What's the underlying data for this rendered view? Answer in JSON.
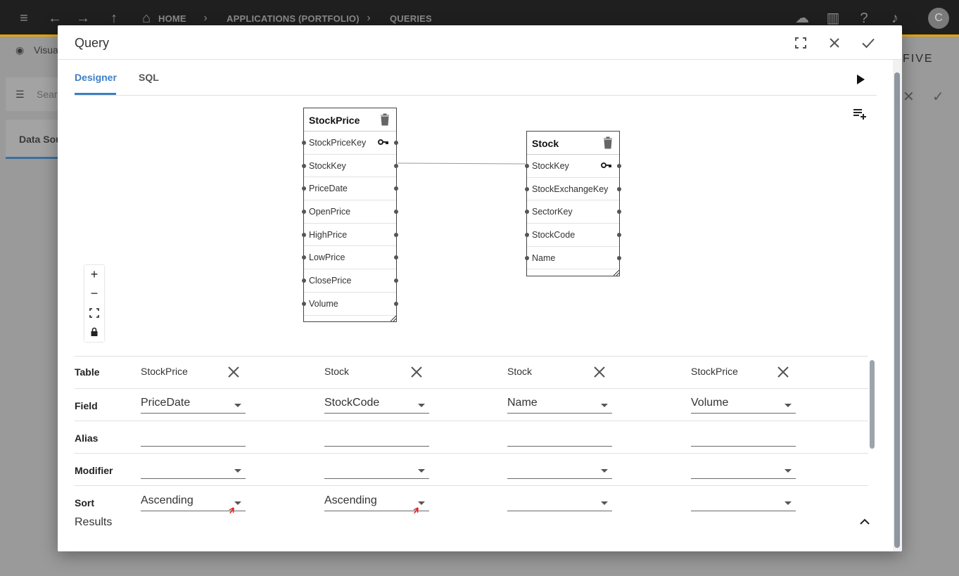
{
  "app_bar": {
    "breadcrumbs": [
      "HOME",
      "APPLICATIONS (PORTFOLIO)",
      "QUERIES"
    ],
    "avatar_initial": "C",
    "brand": "FIVE",
    "accent": "#e5a100"
  },
  "background": {
    "view_label": "Visua",
    "search_placeholder": "Sear",
    "tab_label": "Data Sou"
  },
  "dialog": {
    "title": "Query",
    "tabs": [
      {
        "label": "Designer",
        "active": true
      },
      {
        "label": "SQL",
        "active": false
      }
    ],
    "accent": "#3d7fc4"
  },
  "tables": [
    {
      "name": "StockPrice",
      "fields": [
        "StockPriceKey",
        "StockKey",
        "PriceDate",
        "OpenPrice",
        "HighPrice",
        "LowPrice",
        "ClosePrice",
        "Volume"
      ],
      "key_field": "StockPriceKey"
    },
    {
      "name": "Stock",
      "fields": [
        "StockKey",
        "StockExchangeKey",
        "SectorKey",
        "StockCode",
        "Name"
      ],
      "key_field": "StockKey"
    }
  ],
  "zoom_controls": {
    "zoom_in": "+",
    "zoom_out": "−"
  },
  "grid": {
    "row_labels": {
      "table": "Table",
      "field": "Field",
      "alias": "Alias",
      "modifier": "Modifier",
      "sort": "Sort"
    },
    "columns": [
      {
        "table": "StockPrice",
        "field": "PriceDate",
        "alias": "",
        "modifier": "",
        "sort": "Ascending"
      },
      {
        "table": "Stock",
        "field": "StockCode",
        "alias": "",
        "modifier": "",
        "sort": "Ascending"
      },
      {
        "table": "Stock",
        "field": "Name",
        "alias": "",
        "modifier": "",
        "sort": ""
      },
      {
        "table": "StockPrice",
        "field": "Volume",
        "alias": "",
        "modifier": "",
        "sort": ""
      }
    ]
  },
  "results": {
    "label": "Results"
  }
}
